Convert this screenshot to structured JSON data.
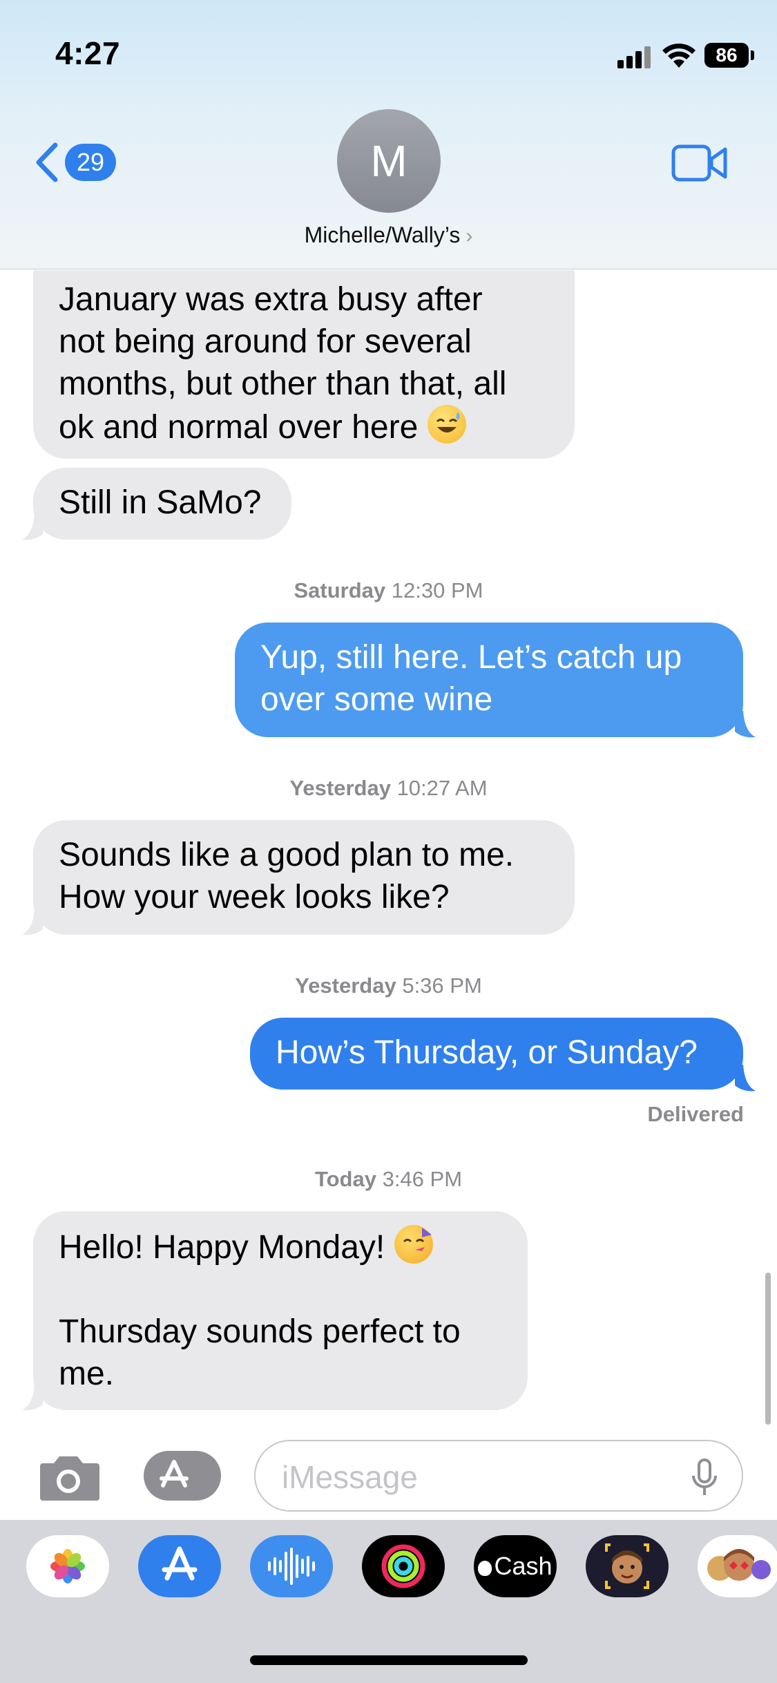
{
  "status_bar": {
    "time": "4:27",
    "battery": "86"
  },
  "header": {
    "back_count": "29",
    "avatar_initial": "M",
    "contact_name": "Michelle/Wally’s",
    "chevron": "›"
  },
  "messages": [
    {
      "kind": "in",
      "lines": [
        "January was extra busy after",
        "not being around for several",
        "months, but other than that, all",
        "ok and normal over here"
      ],
      "emoji": "sweat-smile-emoji"
    },
    {
      "kind": "in",
      "text": "Still in SaMo?"
    },
    {
      "kind": "timestamp",
      "day": "Saturday",
      "time": "12:30 PM"
    },
    {
      "kind": "out",
      "lines": [
        "Yup, still here. Let’s catch up",
        "over some wine"
      ]
    },
    {
      "kind": "timestamp",
      "day": "Yesterday",
      "time": "10:27 AM"
    },
    {
      "kind": "in",
      "lines": [
        "Sounds like a good plan to me.",
        "How your week looks like?"
      ]
    },
    {
      "kind": "timestamp",
      "day": "Yesterday",
      "time": "5:36 PM"
    },
    {
      "kind": "out",
      "text": "How’s Thursday, or Sunday?"
    },
    {
      "kind": "status",
      "text": "Delivered"
    },
    {
      "kind": "timestamp",
      "day": "Today",
      "time": "3:46 PM"
    },
    {
      "kind": "in",
      "lines": [
        "Hello! Happy Monday!",
        "",
        "Thursday sounds perfect to",
        "me."
      ],
      "emoji": "partying-face-emoji"
    }
  ],
  "compose": {
    "placeholder": "iMessage"
  },
  "app_drawer": {
    "apps": [
      {
        "name": "photos-app",
        "label": ""
      },
      {
        "name": "app-store-app",
        "label": ""
      },
      {
        "name": "audio-message-app",
        "label": ""
      },
      {
        "name": "fitness-app",
        "label": ""
      },
      {
        "name": "apple-cash-app",
        "label": "Cash"
      },
      {
        "name": "memoji-app",
        "label": ""
      },
      {
        "name": "memoji-stickers-app",
        "label": ""
      }
    ]
  },
  "colors": {
    "accent": "#2f80ed",
    "incoming_bubble": "#e9e9eb",
    "outgoing_bubble": "#2f80ed",
    "timestamp": "#8a8a8e"
  }
}
